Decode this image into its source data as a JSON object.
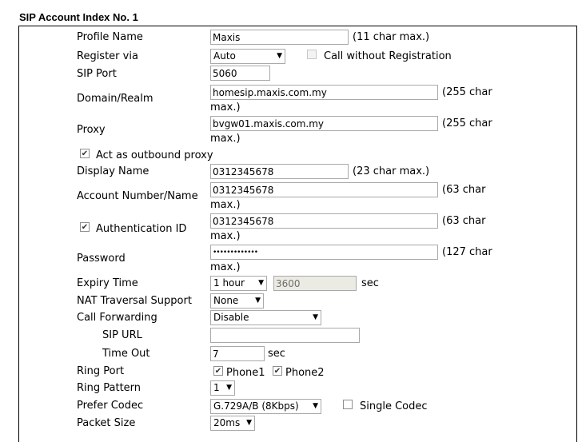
{
  "page_title": "SIP Account Index No. 1",
  "profile_name": {
    "label": "Profile Name",
    "value": "Maxis",
    "hint": "(11 char max.)"
  },
  "register_via": {
    "label": "Register via",
    "value": "Auto",
    "call_without_registration": "Call without Registration",
    "call_without_registration_checked": false
  },
  "sip_port": {
    "label": "SIP Port",
    "value": "5060"
  },
  "domain_realm": {
    "label": "Domain/Realm",
    "value": "homesip.maxis.com.my",
    "hint_line1": "(255 char",
    "hint_line2": "max.)"
  },
  "proxy": {
    "label": "Proxy",
    "value": "bvgw01.maxis.com.my",
    "hint_line1": "(255 char",
    "hint_line2": "max.)"
  },
  "outbound_proxy": {
    "label": "Act as outbound proxy",
    "checked": true
  },
  "display_name": {
    "label": "Display Name",
    "value": "0312345678",
    "hint": "(23 char max.)"
  },
  "account_number": {
    "label": "Account Number/Name",
    "value": "0312345678",
    "hint_line1": "(63 char",
    "hint_line2": "max.)"
  },
  "authentication_id": {
    "label": "Authentication ID",
    "checked": true,
    "value": "0312345678",
    "hint_line1": "(63 char",
    "hint_line2": "max.)"
  },
  "password": {
    "label": "Password",
    "value": "•••••••••••••",
    "hint_line1": "(127 char",
    "hint_line2": "max.)"
  },
  "expiry_time": {
    "label": "Expiry Time",
    "select": "1 hour",
    "value": "3600",
    "unit": "sec"
  },
  "nat_traversal": {
    "label": "NAT Traversal Support",
    "select": "None"
  },
  "call_forwarding": {
    "label": "Call Forwarding",
    "select": "Disable"
  },
  "sip_url": {
    "label": "SIP URL",
    "value": ""
  },
  "time_out": {
    "label": "Time Out",
    "value": "7",
    "unit": "sec"
  },
  "ring_port": {
    "label": "Ring Port",
    "phone1": "Phone1",
    "phone1_checked": true,
    "phone2": "Phone2",
    "phone2_checked": true
  },
  "ring_pattern": {
    "label": "Ring Pattern",
    "select": "1"
  },
  "prefer_codec": {
    "label": "Prefer Codec",
    "select": "G.729A/B (8Kbps)",
    "single_codec": "Single Codec",
    "single_codec_checked": false
  },
  "packet_size": {
    "label": "Packet Size",
    "select": "20ms"
  }
}
